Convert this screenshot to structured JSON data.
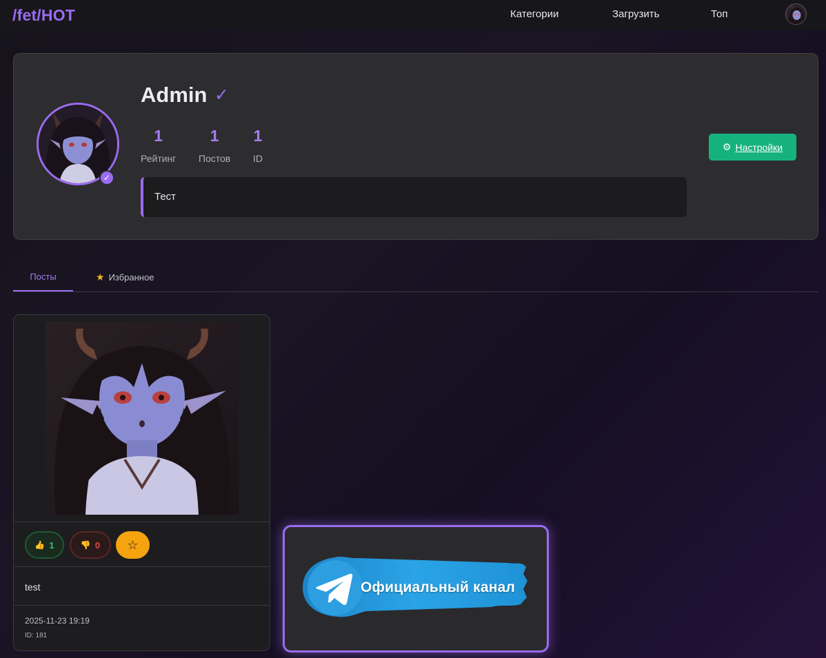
{
  "header": {
    "logo": "/fet/HOT",
    "nav": [
      "Категории",
      "Загрузить",
      "Топ"
    ]
  },
  "profile": {
    "username": "Admin",
    "verified_mark": "✓",
    "badge_mark": "✓",
    "stats": [
      {
        "value": "1",
        "label": "Рейтинг"
      },
      {
        "value": "1",
        "label": "Постов"
      },
      {
        "value": "1",
        "label": "ID"
      }
    ],
    "bio": "Тест",
    "settings_icon": "⚙",
    "settings_label": "Настройки"
  },
  "tabs": {
    "posts": "Посты",
    "favorites_icon": "★",
    "favorites": "Избранное"
  },
  "post": {
    "likes": "1",
    "like_icon": "👍",
    "dislikes": "0",
    "dislike_icon": "👎",
    "fav_icon": "☆",
    "title": "test",
    "date": "2025-11-23 19:19",
    "id": "ID: 181"
  },
  "promo": {
    "text": "Официальный канал"
  },
  "colors": {
    "accent": "#9b6cf0",
    "settings_button": "#16b27e",
    "favorite_button": "#f5a30f",
    "like": "#35c46a",
    "dislike": "#e04848"
  }
}
